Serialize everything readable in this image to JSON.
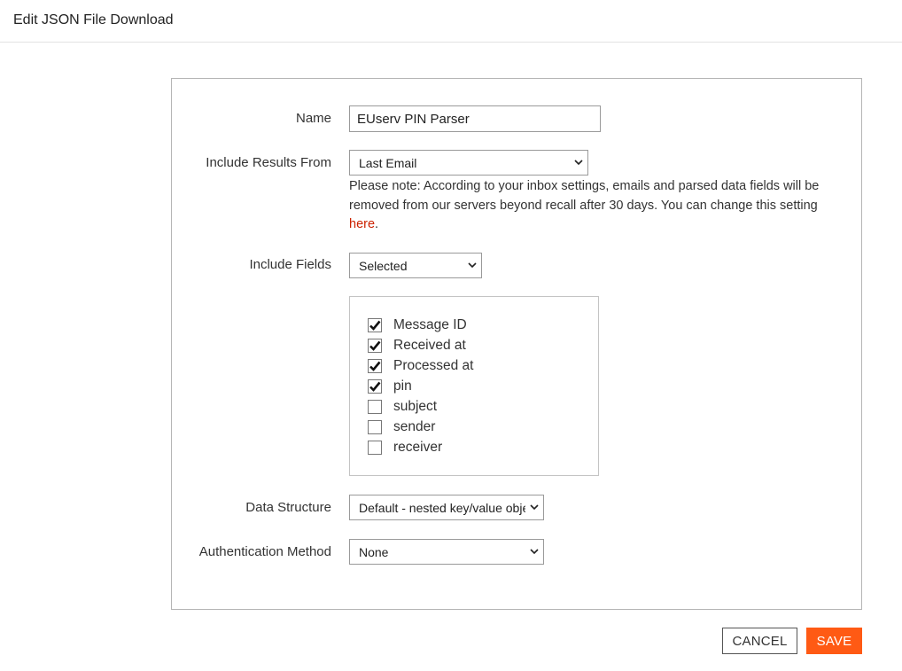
{
  "header": {
    "title": "Edit JSON File Download"
  },
  "form": {
    "name": {
      "label": "Name",
      "value": "EUserv PIN Parser"
    },
    "include_results": {
      "label": "Include Results From",
      "selected": "Last Email",
      "note_text": "Please note: According to your inbox settings, emails and parsed data fields will be removed from our servers beyond recall after 30 days. You can change this setting ",
      "note_link": "here",
      "note_end": "."
    },
    "include_fields": {
      "label": "Include Fields",
      "selected": "Selected",
      "fields": [
        {
          "label": "Message ID",
          "checked": true
        },
        {
          "label": "Received at",
          "checked": true
        },
        {
          "label": "Processed at",
          "checked": true
        },
        {
          "label": "pin",
          "checked": true
        },
        {
          "label": "subject",
          "checked": false
        },
        {
          "label": "sender",
          "checked": false
        },
        {
          "label": "receiver",
          "checked": false
        }
      ]
    },
    "data_structure": {
      "label": "Data Structure",
      "selected": "Default - nested key/value object"
    },
    "auth_method": {
      "label": "Authentication Method",
      "selected": "None"
    }
  },
  "actions": {
    "cancel_label": "CANCEL",
    "save_label": "SAVE"
  },
  "colors": {
    "accent": "#ff5a14",
    "link": "#cc2200"
  }
}
